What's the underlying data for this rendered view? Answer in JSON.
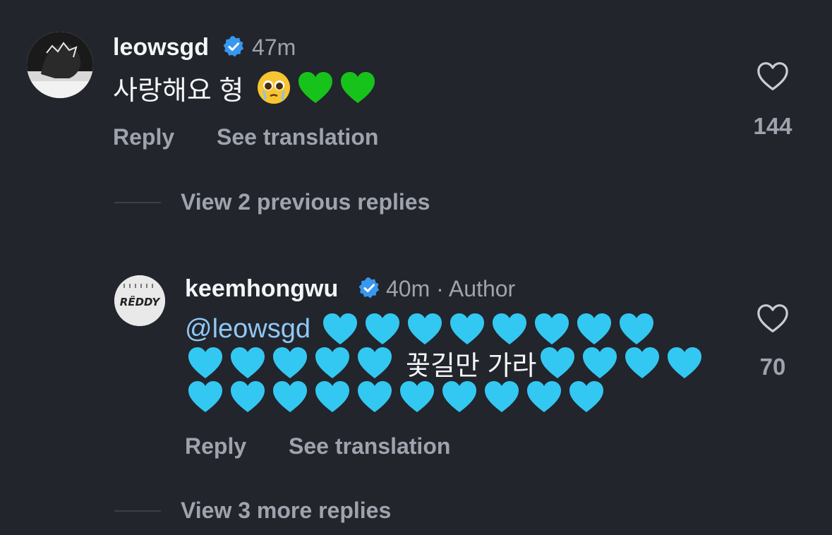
{
  "comments": [
    {
      "username": "leowsgd",
      "time": "47m",
      "text": "사랑해요 형",
      "like_count": "144",
      "actions": {
        "reply": "Reply",
        "translate": "See translation"
      }
    },
    {
      "username": "keemhongwu",
      "time": "40m · Author",
      "mention": "@leowsgd",
      "mid_text": "꽃길만 가라",
      "like_count": "70",
      "avatar_text": "RËDDY",
      "actions": {
        "reply": "Reply",
        "translate": "See translation"
      }
    }
  ],
  "thread": {
    "view_previous": "View 2 previous replies",
    "view_more": "View 3 more replies"
  },
  "colors": {
    "background": "#22252c",
    "muted": "#9ea3ad",
    "verified": "#3897f0",
    "mention": "#8fc8f5",
    "blue_heart": "#33c8f2",
    "green_heart": "#17c21b"
  },
  "icons": {
    "verified": "verified-badge-icon",
    "like": "heart-outline-icon",
    "face": "pleading-face-emoji",
    "green_heart": "green-heart-emoji",
    "light_blue_heart": "light-blue-heart-emoji"
  }
}
